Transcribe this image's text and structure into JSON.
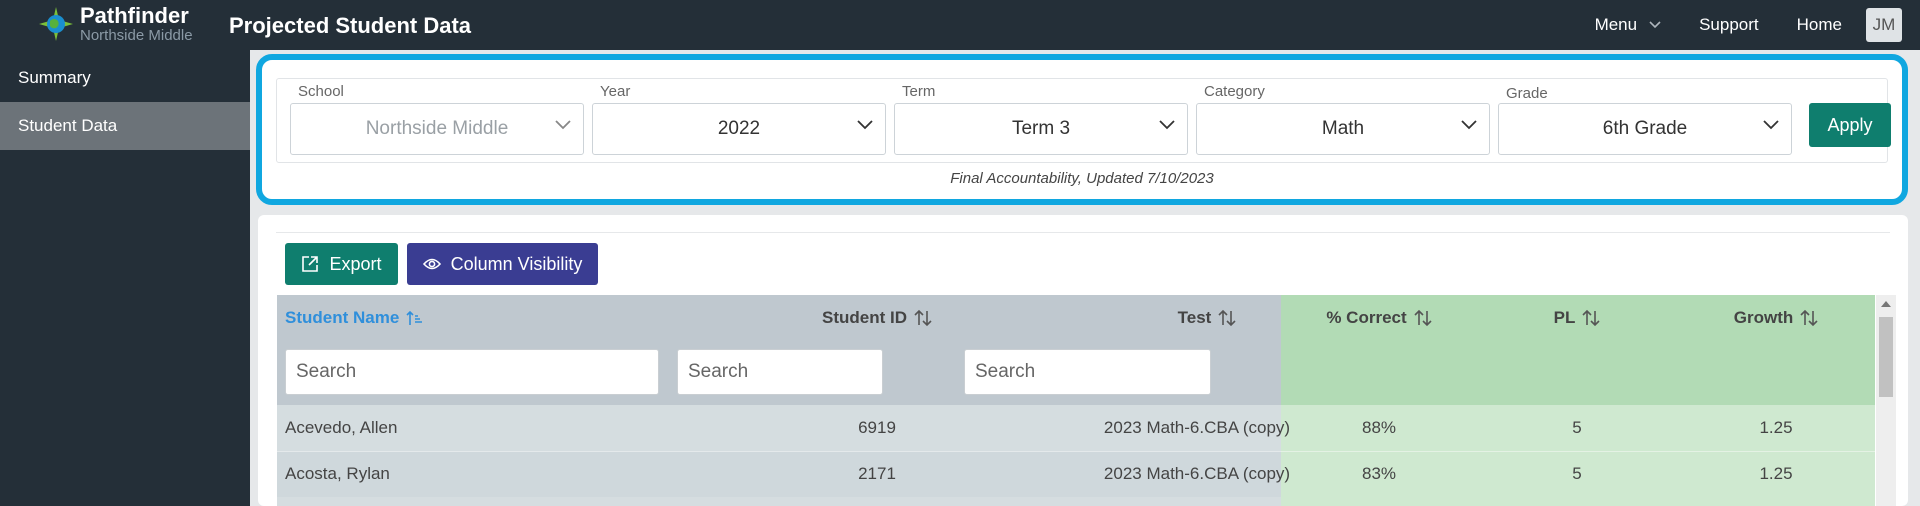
{
  "app": {
    "brand_name": "Pathfinder",
    "brand_school": "Northside Middle",
    "page_title": "Projected Student Data",
    "accent_color": "#10a7e0"
  },
  "nav": {
    "menu_label": "Menu",
    "support_label": "Support",
    "home_label": "Home",
    "user_initials": "JM"
  },
  "sidebar": {
    "items": [
      {
        "label": "Summary",
        "active": false
      },
      {
        "label": "Student Data",
        "active": true
      }
    ]
  },
  "filters": {
    "school": {
      "label": "School",
      "value": "Northside Middle"
    },
    "year": {
      "label": "Year",
      "value": "2022"
    },
    "term": {
      "label": "Term",
      "value": "Term 3"
    },
    "category": {
      "label": "Category",
      "value": "Math"
    },
    "grade": {
      "label": "Grade",
      "value": "6th Grade"
    },
    "apply_label": "Apply",
    "updated_note": "Final Accountability, Updated 7/10/2023"
  },
  "toolbar": {
    "export_label": "Export",
    "column_visibility_label": "Column Visibility"
  },
  "table": {
    "columns": {
      "student_name": "Student Name",
      "student_id": "Student ID",
      "test": "Test",
      "pct_correct": "% Correct",
      "pl": "PL",
      "growth": "Growth"
    },
    "search_placeholder": "Search",
    "rows": [
      {
        "name": "Acevedo, Allen",
        "id": "6919",
        "test": "2023 Math-6.CBA (copy)",
        "pct": "88%",
        "pl": "5",
        "growth": "1.25"
      },
      {
        "name": "Acosta, Rylan",
        "id": "2171",
        "test": "2023 Math-6.CBA (copy)",
        "pct": "83%",
        "pl": "5",
        "growth": "1.25"
      }
    ]
  }
}
